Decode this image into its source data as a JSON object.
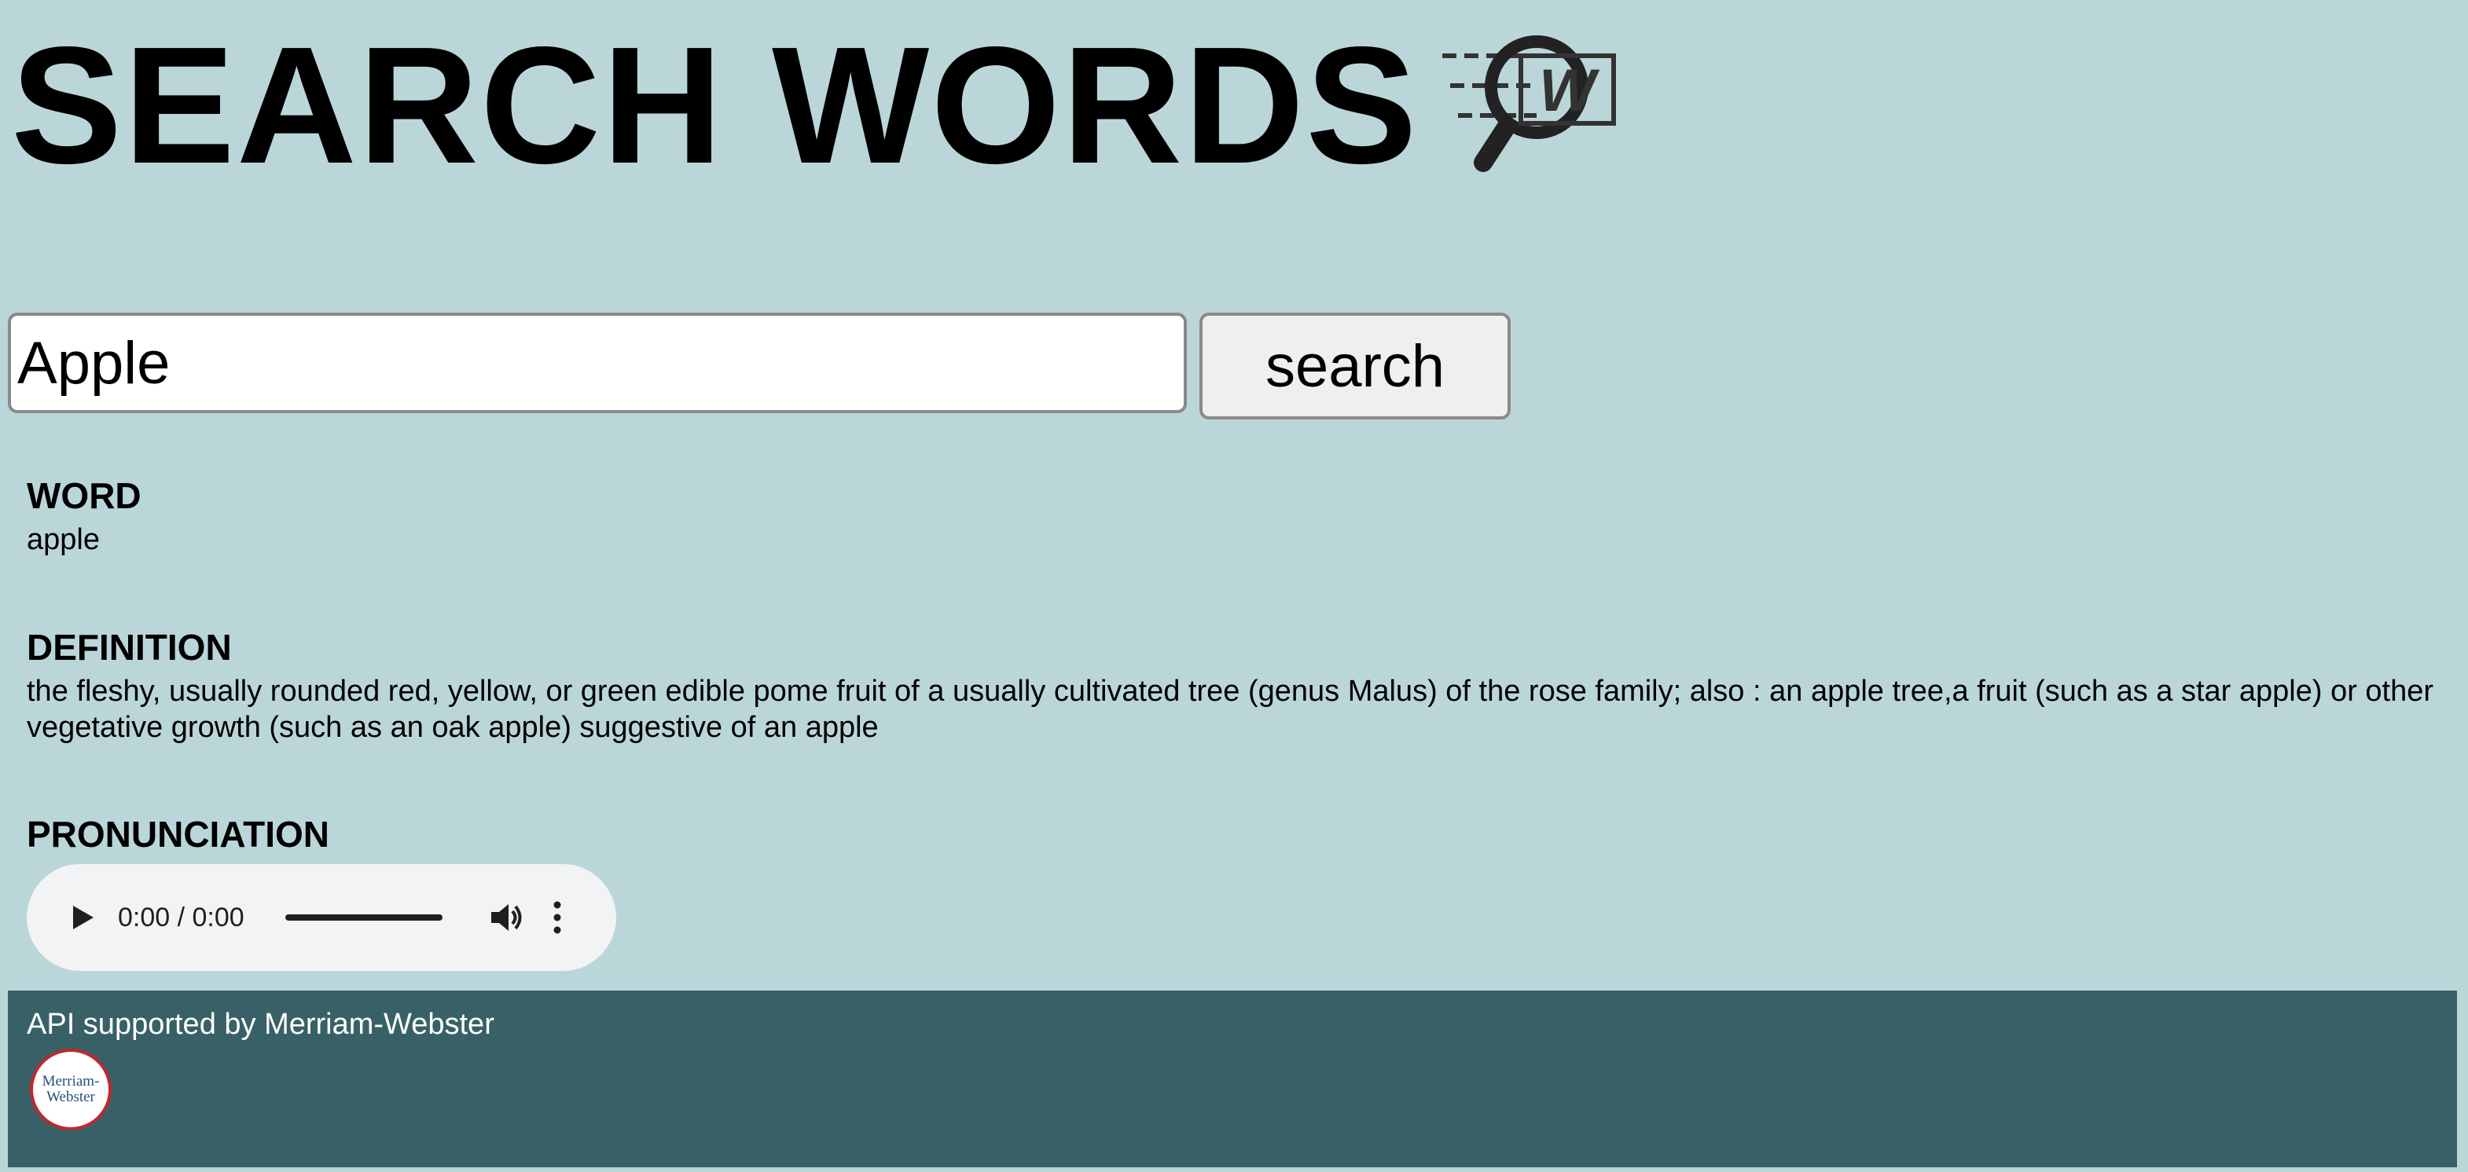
{
  "header": {
    "title": "SEARCH WORDS",
    "logo_icon": "magnifier-w-icon"
  },
  "search": {
    "value": "Apple",
    "button_label": "search"
  },
  "result": {
    "word_label": "WORD",
    "word": "apple",
    "definition_label": "DEFINITION",
    "definition": "the fleshy, usually rounded red, yellow, or green edible pome fruit of a usually cultivated tree (genus Malus) of the rose family; also : an apple tree,a fruit (such as a star apple) or other vegetative growth (such as an oak apple) suggestive of an apple",
    "pronunciation_label": "PRONUNCIATION"
  },
  "audio": {
    "time": "0:00 / 0:00"
  },
  "footer": {
    "text": "API supported by Merriam-Webster",
    "logo_line1": "Merriam-",
    "logo_line2": "Webster"
  }
}
